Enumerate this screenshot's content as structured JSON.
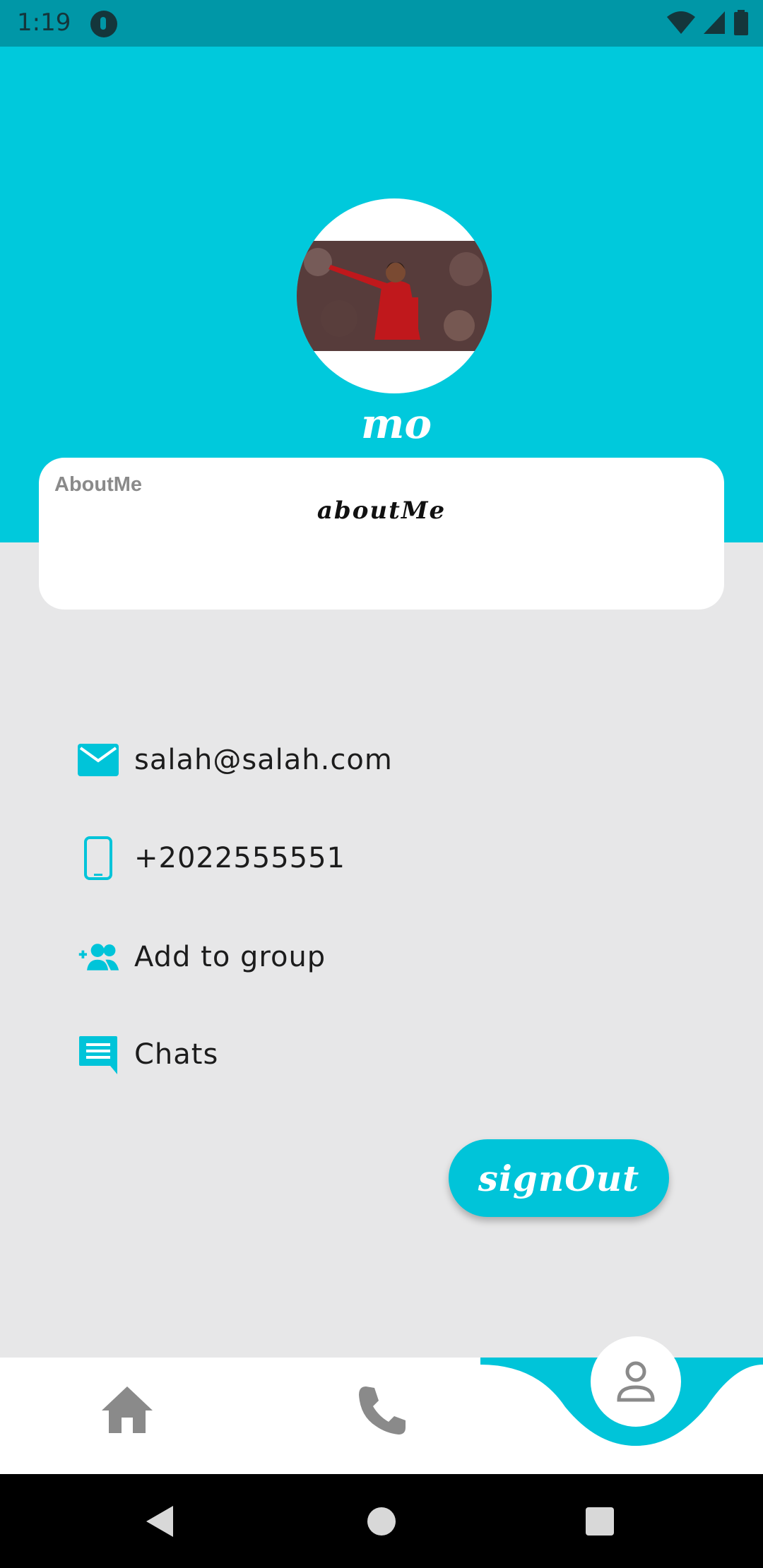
{
  "status_bar": {
    "time": "1:19"
  },
  "profile": {
    "name": "mo",
    "about_label": "AboutMe",
    "about_text": "aboutMe"
  },
  "info": {
    "email": "salah@salah.com",
    "phone": "+2022555551",
    "add_group": "Add to group",
    "chats": "Chats"
  },
  "actions": {
    "sign_out": "signOut"
  },
  "bottom_nav": {
    "items": [
      "home-icon",
      "phone-icon",
      "person-icon"
    ],
    "active": "person-icon"
  },
  "colors": {
    "accent": "#00c9dc",
    "status_bar": "#0097a7",
    "background": "#e7e7e8",
    "card": "#ffffff"
  }
}
